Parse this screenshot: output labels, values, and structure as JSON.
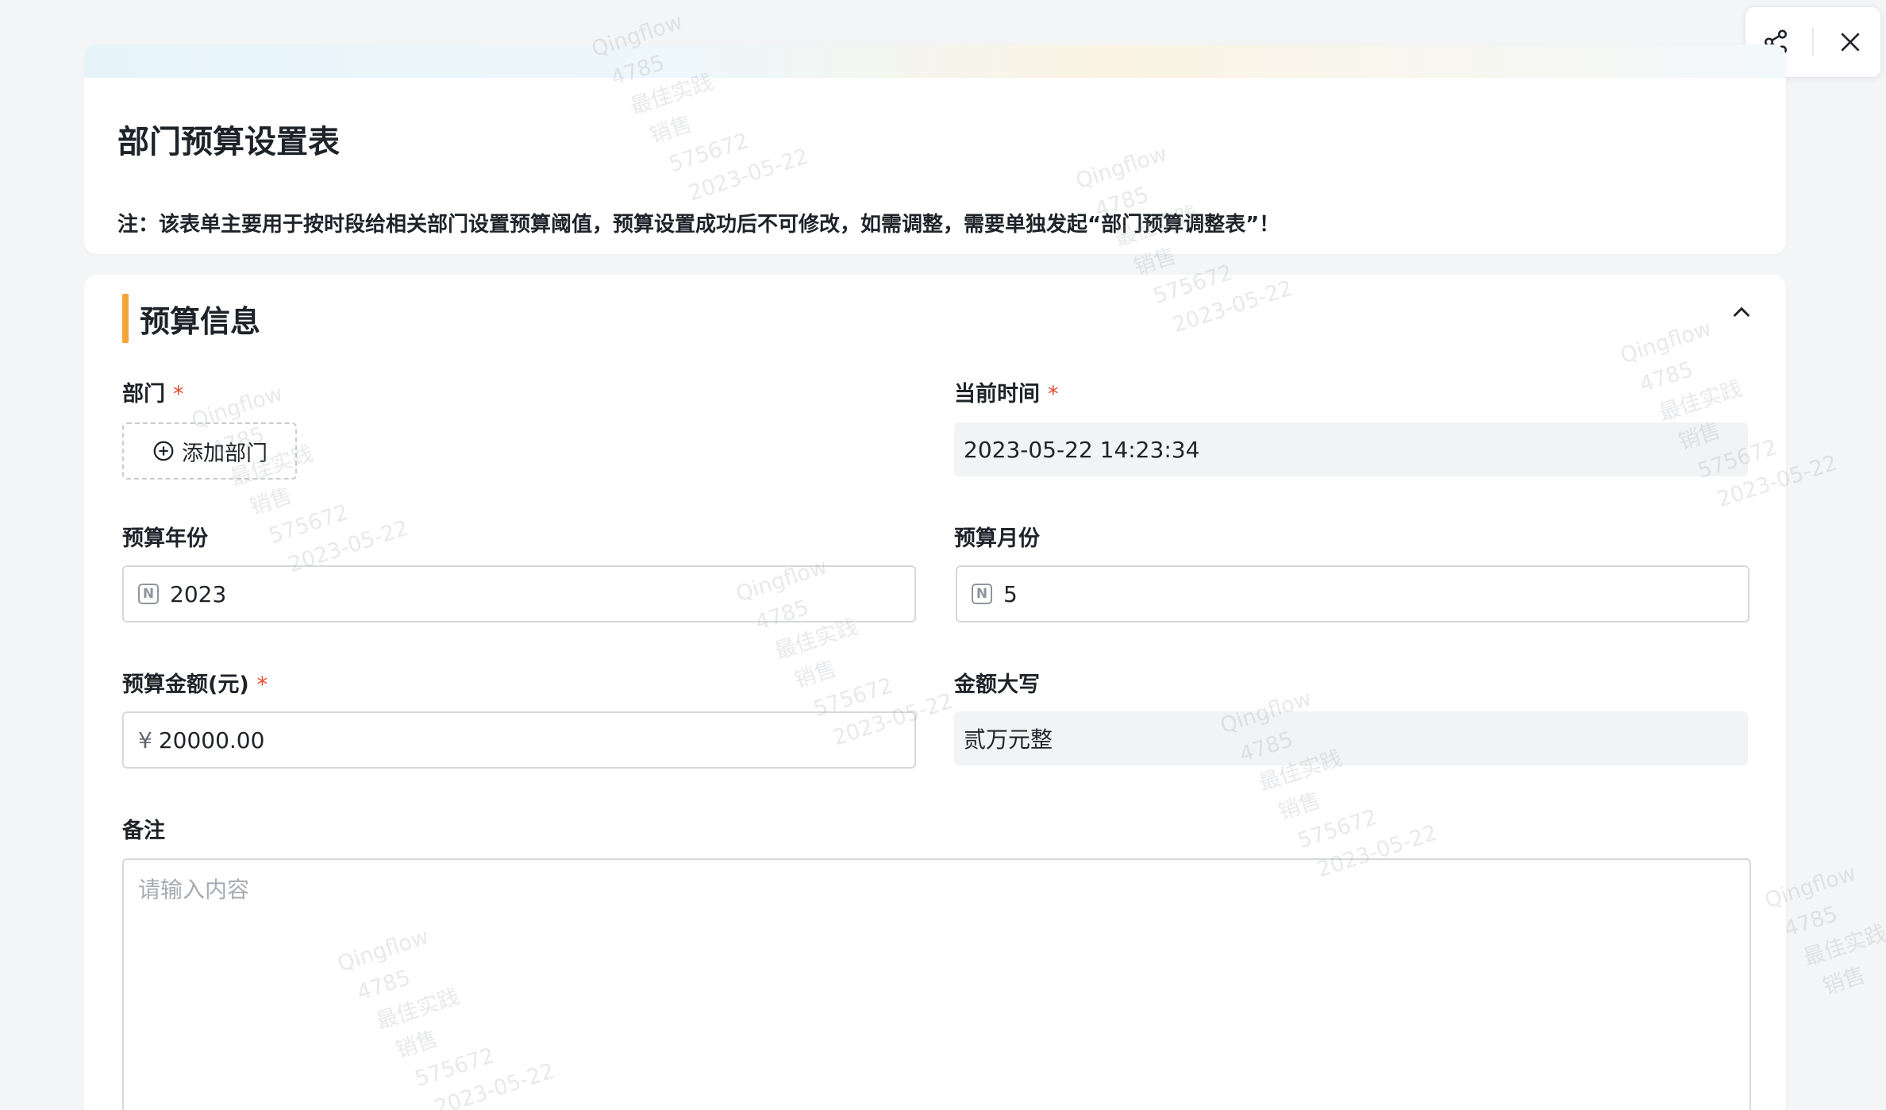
{
  "header": {
    "title": "部门预算设置表",
    "note": "注：该表单主要用于按时段给相关部门设置预算阈值，预算设置成功后不可修改，如需调整，需要单独发起“部门预算调整表”！"
  },
  "top_actions": {
    "share_icon": "share-icon",
    "close_icon": "close-icon"
  },
  "section": {
    "title": "预算信息",
    "collapse_icon": "chevron-up-icon",
    "accent_color": "#f5a43a"
  },
  "fields": {
    "department": {
      "label": "部门",
      "required_mark": "*",
      "add_button": "添加部门"
    },
    "current_time": {
      "label": "当前时间",
      "required_mark": "*",
      "value": "2023-05-22 14:23:34"
    },
    "budget_year": {
      "label": "预算年份",
      "value": "2023",
      "type_icon": "N"
    },
    "budget_month": {
      "label": "预算月份",
      "value": "5",
      "type_icon": "N"
    },
    "budget_amount": {
      "label": "预算金额(元)",
      "required_mark": "*",
      "currency": "¥",
      "value": "20000.00"
    },
    "amount_uppercase": {
      "label": "金额大写",
      "value": "贰万元整"
    },
    "remarks": {
      "label": "备注",
      "placeholder": "请输入内容"
    }
  },
  "watermark": {
    "lines": [
      "Qingflow",
      "4785",
      "最佳实践",
      "销售",
      "575672",
      "2023-05-22"
    ]
  },
  "colors": {
    "required": "#e6492d",
    "readonly_bg": "#f2f3f4",
    "border": "#d5d8dc"
  }
}
